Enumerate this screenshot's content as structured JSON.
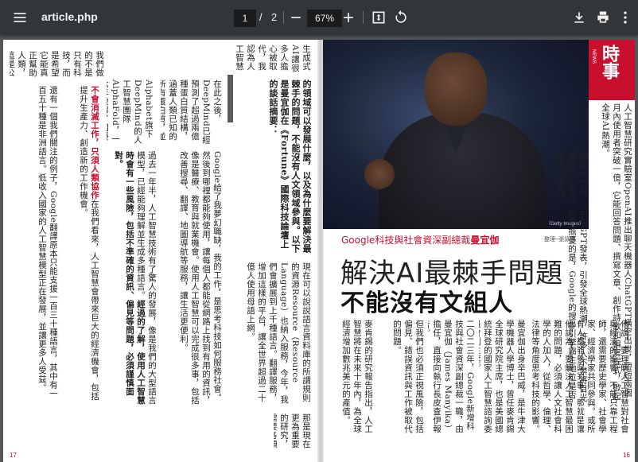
{
  "toolbar": {
    "title": "article.php",
    "page_current": "1",
    "page_separator": "/",
    "page_total": "2",
    "zoom": "67%"
  },
  "article": {
    "photo_caption": "（Getty Images）",
    "section_kanji": "時事",
    "section_en": "NEWS",
    "subtitle_prefix": "Google科技與社會資深副總裁",
    "subtitle_name": "曼宜伽",
    "reporter": "整理─張詠晴",
    "headline_line1": "解決AI最棘手問題",
    "headline_line2": "不能沒有文組人",
    "page_left": "17",
    "page_right": "16",
    "col_r1": "人工智慧研究實驗室OpenAI推出聊天機器人ChatGPT橫空出世，短短兩個月內使用者突破一億，它能回答問題、撰寫文章、創作詩歌和編寫程式，掀起全球AI熱潮。",
    "col_r2": "去年十一月，ChatGPT發表，引發全球熱潮，許多人不禁將目光轉向Google。他們擔憂的是，Google的搜尋引擎霸主地位是否將受到威脅。",
    "col_r3": "二〇二三年，Google新增科技與社會資深副總裁一職，由曼宜伽（James Manyika）擔任，直接向執行長皮查伊報告。",
    "col_r4": "曼宜伽出身辛巴威，是牛津大學機器人學博士，曾任麥肯錫全球研究院主席，也是美國總統拜登的國家人工智慧諮詢委員會副主席。",
    "col_r5": "他認為，要解決人工智慧最困難的問題，必須讓人文社會科學的人加入，從哲學、倫理、法律等角度思考科技的影響。",
    "col_r6": "他說，要理解人工智慧對社會與經濟的影響，不能只靠工程師，還需要歷史學家、社會學家、經濟學家共同參與。",
    "col_r7": "或所有人都能參與的事，那就是讓這項技術真正造福人類社會。",
    "col_m1": "現在可以說說語言資料庫的所謂規則的資源Resource（Resource Language）也納入服務，今年，我們會擴展到上千種語言。",
    "col_m2": "翻譯服務，增加這樣的平台，讓全世界超過二十億人使用母語上網。",
    "col_m3": "Alphabet旗下DeepMind的人工智慧團隊AlphaFold，一六年破解了困擾科學家五十年的蛋白質摺疊問題。",
    "col_m4": "在此之後，DeepMind已經預測了超過兩億種蛋白質結構，涵蓋人類已知的所有蛋白質，並免費公開給全世界科學家使用。",
    "col_m5": "我們做的不是只有科技，而是希望它能真正幫助人類，這是公司的使命。",
    "col_m6": "麥肯錫的研究報告指出，人工智慧將在未來十年內，為全球經濟增加數兆美元的產值。",
    "col_m7": "但我們也必須正視風險，包括偏見、錯誤資訊與工作被取代的問題。",
    "col_m8": "生成式AI讓很多人擔心被取代，我認為人工智慧帶來的是工作的轉變。",
    "col_m9": "那是現在更為重要的研究，需要各領域的專家共同投入，深入了解人類社會。",
    "col_l1": "的領域可以發展什麼，以及為什麼要解決最棘手的問題，不能沒有人文領域參與。以下是曼宜伽在《Fortune》國際科技論壇上的談話摘要：",
    "col_l2": "Google給了我夢幻職缺，我的工作，是思考科技如何服務社會。",
    "col_l3": "然後到哪裡都能夠使用，讓每個人都能從網路上找到有用的資訊，像是醫療、教育與就業機會。",
    "col_l4": "使用人工智慧可以完成很多事，包括改善搜尋、翻譯、地圖導航等服務，讓生活更便利。",
    "col_l5": "過去一年半，人工智慧技術有了驚人的發展，像是我們的大型語言模型，已經能夠理解並生成多種語言。",
    "col_l6": "經過的了解，使用人工智慧時會有一些風險，包括不準確的資訊、偏見等問題，必須謹慎面對。",
    "col_l7": "還有一個我們關注的例子，Google翻譯原本只能支援一百三十種語言，其中有一百五十種是非洲語言。",
    "col_l8": "低收入國家的人工智慧模型正在發展，並讓更多人受益。",
    "col_l9": "不會消滅工作，只須人類協作",
    "col_l10": "在我們看來，人工智慧會帶來巨大的經濟機會，包括提升生產力、創造新的工作機會。"
  },
  "colors": {
    "toolbar_bg": "#323639",
    "viewer_bg": "#525659",
    "accent_red": "#c8102e"
  }
}
